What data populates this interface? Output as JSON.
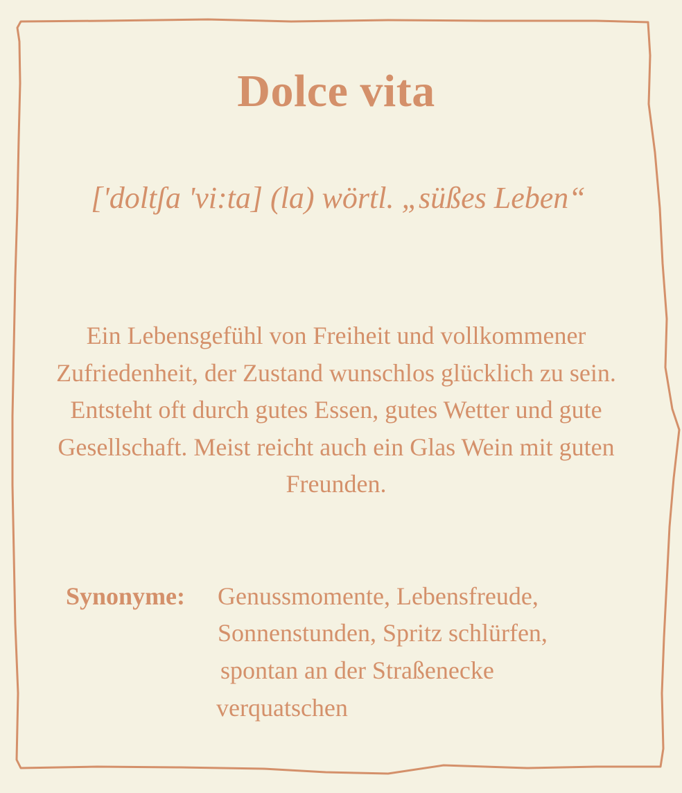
{
  "card": {
    "title": "Dolce vita",
    "pronunciation": "['doltʃa 'vi:ta] (la) wörtl. „süßes Leben“",
    "definition": "Ein Lebensgefühl von Freiheit und vollkommener Zufriedenheit, der Zustand wunschlos glücklich zu sein. Entsteht oft durch gutes Essen, gutes Wetter und gute Gesellschaft. Meist reicht auch ein Glas Wein mit guten Freunden.",
    "synonyms_label": "Synonyme:",
    "synonyms_lines": [
      "Genussmomente, Lebensfreude,",
      "Sonnenstunden, Spritz schlürfen,",
      "spontan an der Straßenecke",
      "verquatschen"
    ]
  },
  "colors": {
    "background": "#f5f2e2",
    "accent": "#d4906a"
  }
}
